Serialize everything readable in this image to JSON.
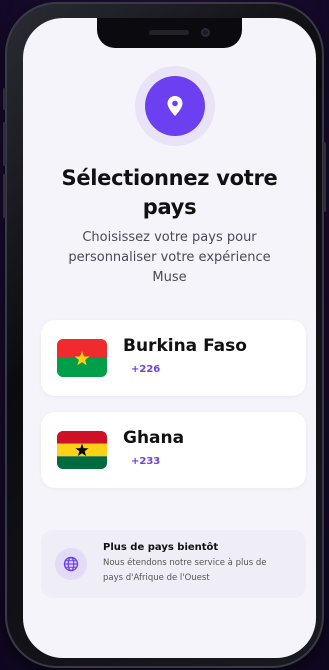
{
  "colors": {
    "accent": "#6c3ff0",
    "screen_background": "#f6f4fb",
    "card_background": "#ffffff"
  },
  "header": {
    "icon": "location-pin-icon",
    "title_line1": "Sélectionnez votre",
    "title_line2": "pays",
    "subtitle_line1": "Choisissez votre pays pour",
    "subtitle_line2": "personnaliser votre expérience",
    "subtitle_line3": "Muse"
  },
  "countries": [
    {
      "name": "Burkina Faso",
      "code": "+226",
      "flag": "burkina-faso-flag-icon",
      "flag_colors": [
        "#ef2b2d",
        "#009e49",
        "#fcd116"
      ]
    },
    {
      "name": "Ghana",
      "code": "+233",
      "flag": "ghana-flag-icon",
      "flag_colors": [
        "#ce1126",
        "#fcd116",
        "#006b3f",
        "#000000"
      ]
    }
  ],
  "info": {
    "icon": "globe-icon",
    "title": "Plus de pays bientôt",
    "text_line1": "Nous étendons notre service à plus de",
    "text_line2": "pays d'Afrique de l'Ouest"
  }
}
